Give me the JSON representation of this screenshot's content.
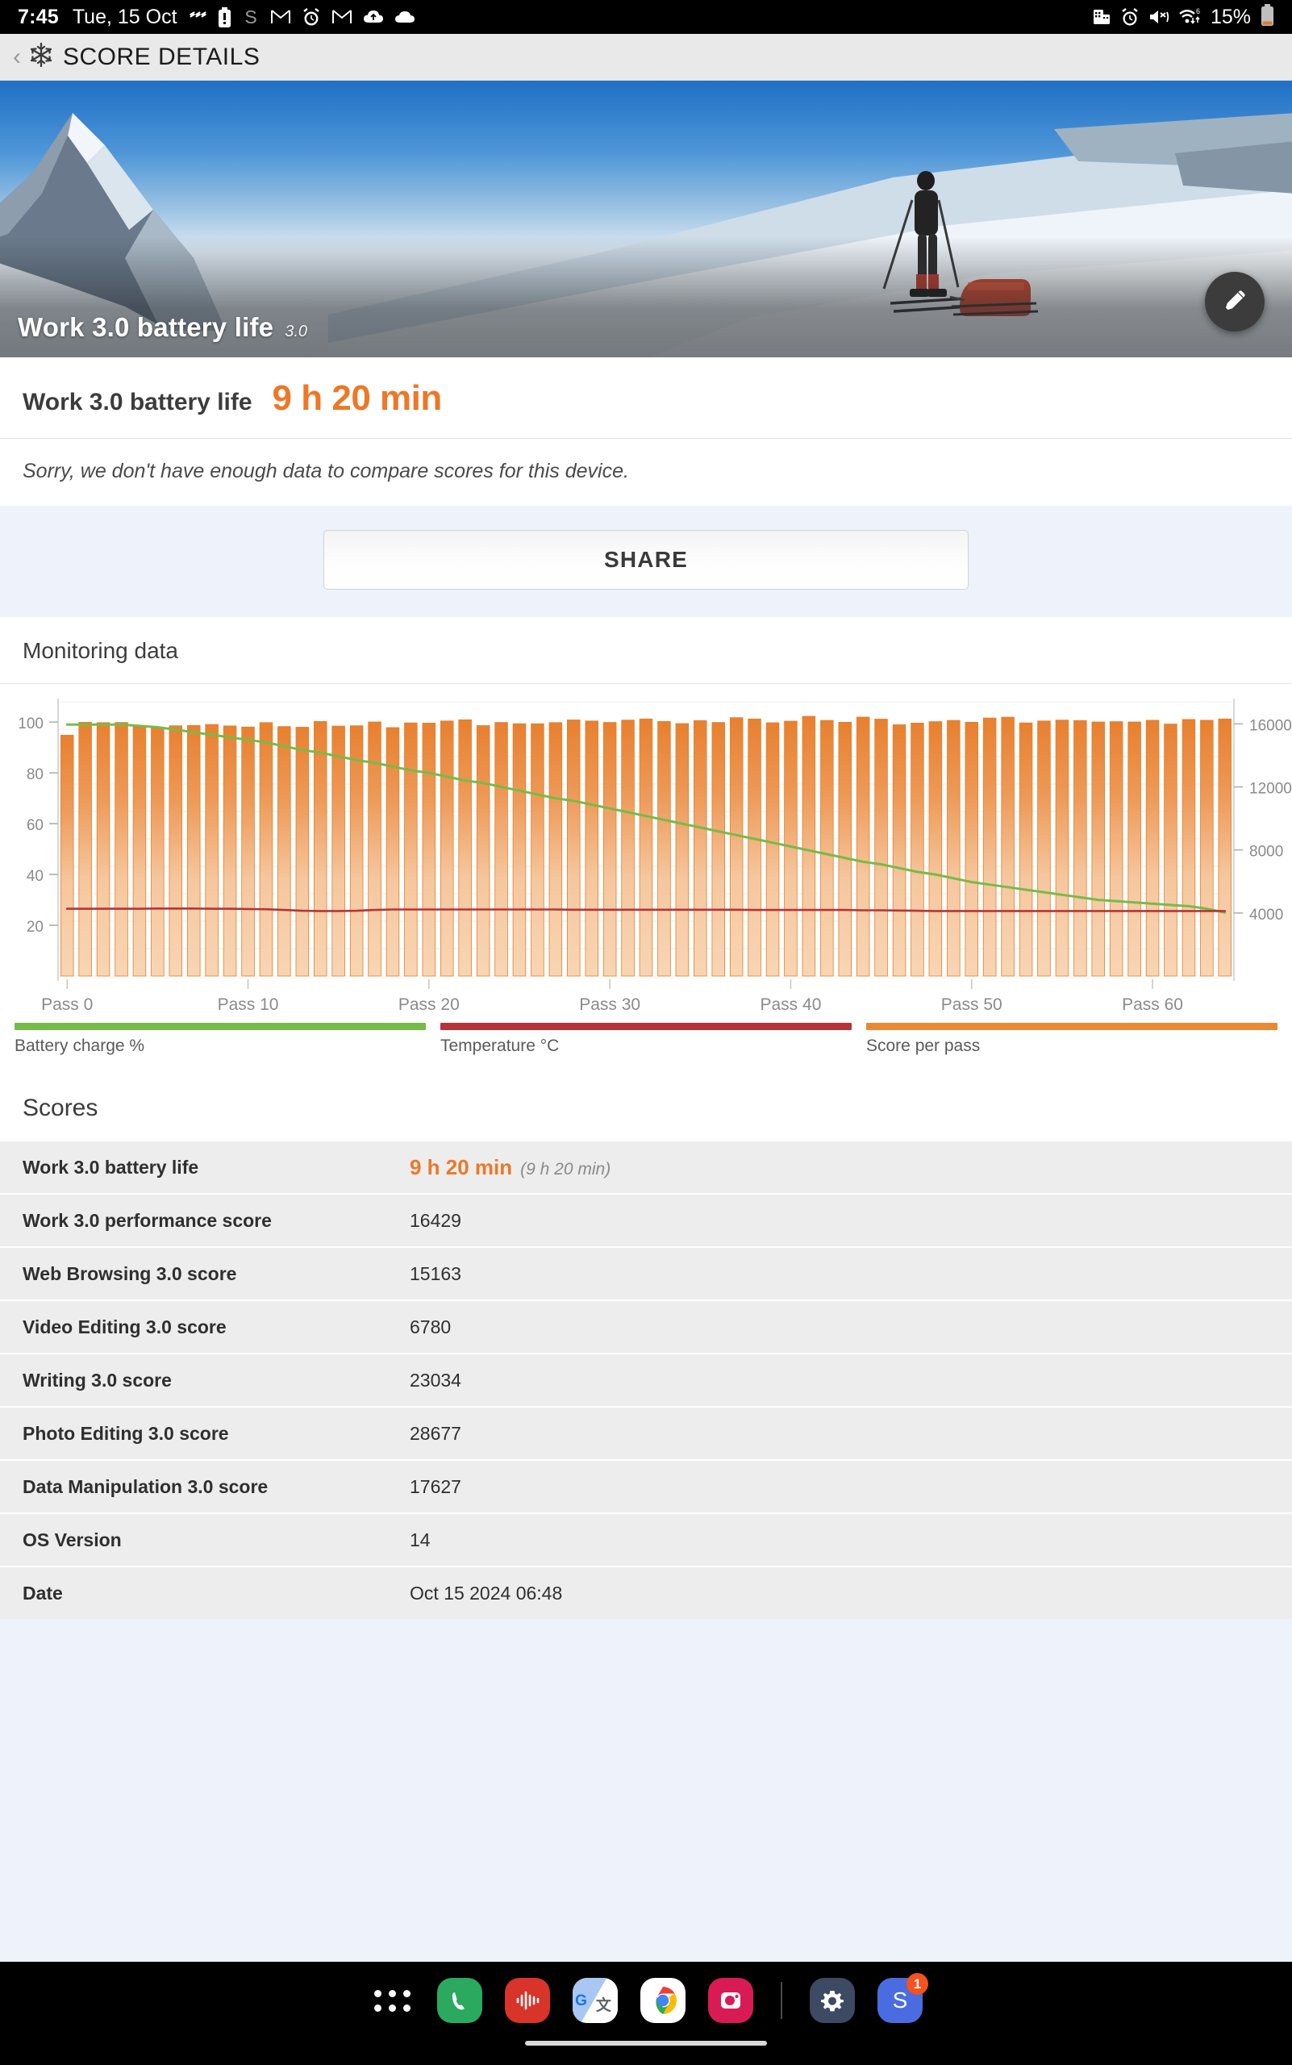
{
  "status_bar": {
    "time": "7:45",
    "date": "Tue, 15 Oct",
    "battery_percent": "15%",
    "left_icons": [
      "vibrate-icon",
      "battery-saver-icon",
      "samsung-s-icon",
      "gmail-icon",
      "alarm-clock-icon",
      "gmail-icon",
      "cloud-upload-icon",
      "cloud-icon"
    ],
    "right_icons": [
      "sim-card-icon",
      "alarm-clock-icon",
      "mute-vibrate-icon",
      "wifi-icon"
    ]
  },
  "app_bar": {
    "back_label": "‹",
    "icon": "snowflake-icon",
    "title": "SCORE DETAILS"
  },
  "hero": {
    "benchmark_name": "Work 3.0 battery life",
    "version": "3.0",
    "edit_icon": "pencil-icon"
  },
  "score_header": {
    "label": "Work 3.0 battery life",
    "value": "9 h 20 min"
  },
  "comparison_notice": "Sorry, we don't have enough data to compare scores for this device.",
  "share": {
    "label": "SHARE"
  },
  "monitoring": {
    "title": "Monitoring data"
  },
  "scores": {
    "title": "Scores",
    "rows": [
      {
        "key": "Work 3.0 battery life",
        "value": "9 h 20 min",
        "sub": "(9 h 20 min)",
        "highlight": true
      },
      {
        "key": "Work 3.0 performance score",
        "value": "16429",
        "sub": "",
        "highlight": false
      },
      {
        "key": "Web Browsing 3.0 score",
        "value": "15163",
        "sub": "",
        "highlight": false
      },
      {
        "key": "Video Editing 3.0 score",
        "value": "6780",
        "sub": "",
        "highlight": false
      },
      {
        "key": "Writing 3.0 score",
        "value": "23034",
        "sub": "",
        "highlight": false
      },
      {
        "key": "Photo Editing 3.0 score",
        "value": "28677",
        "sub": "",
        "highlight": false
      },
      {
        "key": "Data Manipulation 3.0 score",
        "value": "17627",
        "sub": "",
        "highlight": false
      },
      {
        "key": "OS Version",
        "value": "14",
        "sub": "",
        "highlight": false
      },
      {
        "key": "Date",
        "value": "Oct 15 2024 06:48",
        "sub": "",
        "highlight": false
      }
    ]
  },
  "dock": {
    "apps": [
      "app-drawer-icon",
      "phone-icon",
      "voice-recorder-icon",
      "google-translate-icon",
      "chrome-icon",
      "instagram-icon",
      "divider",
      "settings-icon",
      "samsung-smartthings-icon"
    ],
    "badge_count": "1"
  },
  "colors": {
    "accent_orange": "#ec7828",
    "bar_orange_top": "#e8802f",
    "bar_orange_bottom": "#f8d5b4",
    "battery_green": "#76bb4a",
    "temperature_red": "#b5343a",
    "score_legend_orange": "#e88a34",
    "page_bg": "#eef2fa",
    "card_bg": "#ffffff",
    "row_bg": "#ededed"
  },
  "chart_data": {
    "type": "bar",
    "title": "Monitoring data",
    "xlabel": "",
    "ylabel": "Battery charge %",
    "ylabel_right": "Score per pass",
    "grid": true,
    "legend_position": "bottom",
    "x_tick_labels": [
      "Pass 0",
      "Pass 10",
      "Pass 20",
      "Pass 30",
      "Pass 40",
      "Pass 50",
      "Pass 60"
    ],
    "x_tick_values": [
      0,
      10,
      20,
      30,
      40,
      50,
      60
    ],
    "xlim": [
      -0.5,
      64.5
    ],
    "left_axis": {
      "label": "Battery charge % / Temperature °C",
      "ticks": [
        20,
        40,
        60,
        80,
        100
      ],
      "ylim": [
        0,
        108
      ]
    },
    "right_axis": {
      "label": "Score per pass",
      "ticks": [
        4000,
        8000,
        12000,
        16000
      ],
      "ylim": [
        0,
        17400
      ]
    },
    "series": [
      {
        "name": "Score per pass",
        "type": "bar",
        "axis": "right",
        "color": "#e8802f",
        "values": [
          15280,
          16100,
          16080,
          16090,
          15820,
          15760,
          15880,
          15900,
          15960,
          15870,
          15800,
          16080,
          15830,
          15790,
          16150,
          15860,
          15880,
          16120,
          15760,
          16060,
          16050,
          16180,
          16260,
          15890,
          16090,
          16010,
          16010,
          16080,
          16250,
          16180,
          16090,
          16240,
          16310,
          16150,
          16020,
          16210,
          16090,
          16390,
          16310,
          16070,
          16170,
          16480,
          16220,
          16100,
          16430,
          16300,
          15940,
          16050,
          16140,
          16220,
          16100,
          16370,
          16420,
          16060,
          16180,
          16240,
          16210,
          16120,
          16140,
          16120,
          16230,
          15990,
          16280,
          16230,
          16310
        ]
      },
      {
        "name": "Battery charge %",
        "type": "line",
        "axis": "left",
        "color": "#76bb4a",
        "values": [
          99,
          99,
          99,
          99,
          98.5,
          98,
          97,
          96,
          95,
          94,
          93,
          92,
          90.5,
          89,
          88,
          86.5,
          85,
          84,
          82.5,
          81,
          80,
          78.5,
          77,
          76,
          74.5,
          73,
          71.5,
          70,
          69,
          67.5,
          66,
          64.5,
          63,
          61.5,
          60,
          58.5,
          57,
          55.5,
          54,
          52.5,
          51,
          49.5,
          48,
          46.5,
          45,
          44,
          42.5,
          41,
          40,
          38.5,
          37,
          36,
          35,
          34,
          33,
          32,
          31,
          30,
          29.5,
          29,
          28.5,
          28,
          27.5,
          26.5,
          25
        ]
      },
      {
        "name": "Temperature °C",
        "type": "line",
        "axis": "left",
        "color": "#b5343a",
        "values": [
          26.5,
          26.5,
          26.5,
          26.5,
          26.5,
          26.6,
          26.6,
          26.6,
          26.5,
          26.5,
          26.4,
          26.3,
          26.0,
          25.7,
          25.6,
          25.6,
          25.7,
          26.0,
          26.2,
          26.2,
          26.2,
          26.2,
          26.2,
          26.2,
          26.2,
          26.2,
          26.2,
          26.2,
          26.1,
          26.1,
          26.1,
          26.1,
          26.1,
          26.1,
          26.1,
          26.1,
          26.1,
          26.1,
          26.0,
          26.0,
          26.0,
          26.0,
          26.0,
          26.0,
          25.9,
          25.9,
          25.8,
          25.7,
          25.6,
          25.6,
          25.6,
          25.6,
          25.6,
          25.6,
          25.6,
          25.6,
          25.6,
          25.6,
          25.6,
          25.6,
          25.6,
          25.6,
          25.6,
          25.6,
          25.6
        ]
      }
    ],
    "legend": [
      {
        "label": "Battery charge %",
        "color": "#76bb4a"
      },
      {
        "label": "Temperature °C",
        "color": "#b5343a"
      },
      {
        "label": "Score per pass",
        "color": "#e88a34"
      }
    ]
  }
}
